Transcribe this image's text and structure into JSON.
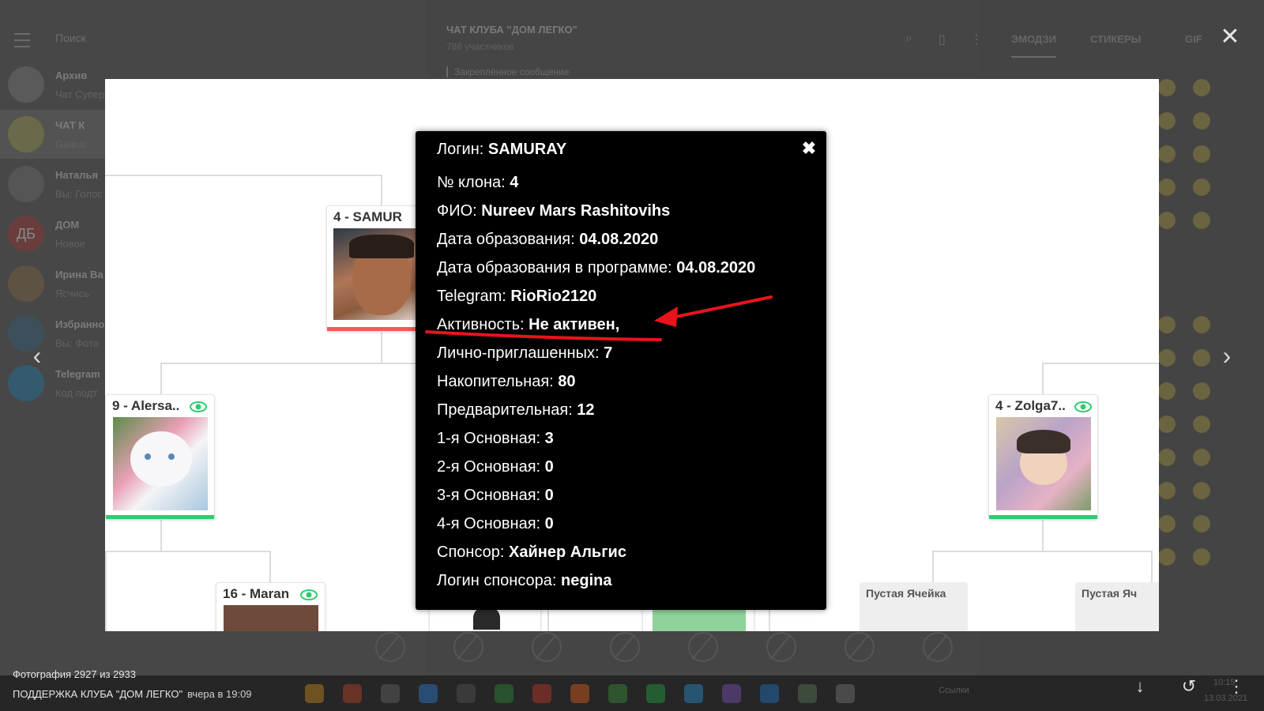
{
  "background": {
    "search_placeholder": "Поиск",
    "chats": [
      {
        "name": "Архив",
        "sub": "Чат Супер"
      },
      {
        "name": "ЧАТ К",
        "sub": "Galina: "
      },
      {
        "name": "Наталья",
        "sub": "Вы: Голос"
      },
      {
        "name": "ДОМ",
        "sub": "Новое",
        "avatar": "ДБ"
      },
      {
        "name": "Ирина Ва",
        "sub": "Ясчись"
      },
      {
        "name": "Избранно",
        "sub": "Вы: Фото"
      },
      {
        "name": "Telegram",
        "sub": "Код подт"
      }
    ],
    "chat_title": "ЧАТ КЛУБА \"ДОМ ЛЕГКО\"",
    "chat_members": "786 участников",
    "pinned": "Закреплённое сообщение",
    "panel_tabs": [
      "ЭМОДЗИ",
      "СТИКЕРЫ",
      "GIF"
    ],
    "taskbar_links": "Ссылки",
    "taskbar_time": "10:15",
    "taskbar_date": "13.03.2021"
  },
  "viewer": {
    "caption": "Фотография 2927 из 2933",
    "sender": "ПОДДЕРЖКА КЛУБА \"ДОМ ЛЕГКО\"",
    "time": "вчера в 19:09"
  },
  "tree": {
    "cards": [
      {
        "title": "4 - SAMUR",
        "bar_color": "#f05a5a"
      },
      {
        "title": "9 - Alersa..",
        "bar_color": "#2ecc71"
      },
      {
        "title": "4 - Zolga7..",
        "bar_color": "#2ecc71"
      },
      {
        "title": "16 - Maran",
        "bar_color": "#2ecc71"
      }
    ],
    "empty_cards": [
      "Пустая Ячейка",
      "Пустая Яч"
    ]
  },
  "modal": {
    "rows": [
      {
        "label": "Логин:",
        "value": "SAMURAY"
      },
      {
        "label": "№ клона:",
        "value": "4"
      },
      {
        "label": "ФИО:",
        "value": "Nureev Mars Rashitovihs"
      },
      {
        "label": "Дата образования:",
        "value": "04.08.2020"
      },
      {
        "label": "Дата образования в программе:",
        "value": "04.08.2020"
      },
      {
        "label": "Telegram:",
        "value": "RioRio2120"
      },
      {
        "label": "Активность:",
        "value": "Не активен,"
      },
      {
        "label": "Лично-приглашенных:",
        "value": "7"
      },
      {
        "label": "Накопительная:",
        "value": "80"
      },
      {
        "label": "Предварительная:",
        "value": "12"
      },
      {
        "label": "1-я Основная:",
        "value": "3"
      },
      {
        "label": "2-я Основная:",
        "value": "0"
      },
      {
        "label": "3-я Основная:",
        "value": "0"
      },
      {
        "label": "4-я Основная:",
        "value": "0"
      },
      {
        "label": "Спонсор:",
        "value": "Хайнер Альгис"
      },
      {
        "label": "Логин спонсора:",
        "value": "negina"
      }
    ],
    "annotation_color": "#e8141b"
  },
  "icons": {
    "close": "close-icon",
    "prev": "chevron-left-icon",
    "next": "chevron-right-icon",
    "download": "download-icon",
    "rotate": "rotate-icon",
    "more": "more-vertical-icon",
    "eye": "eye-icon"
  }
}
